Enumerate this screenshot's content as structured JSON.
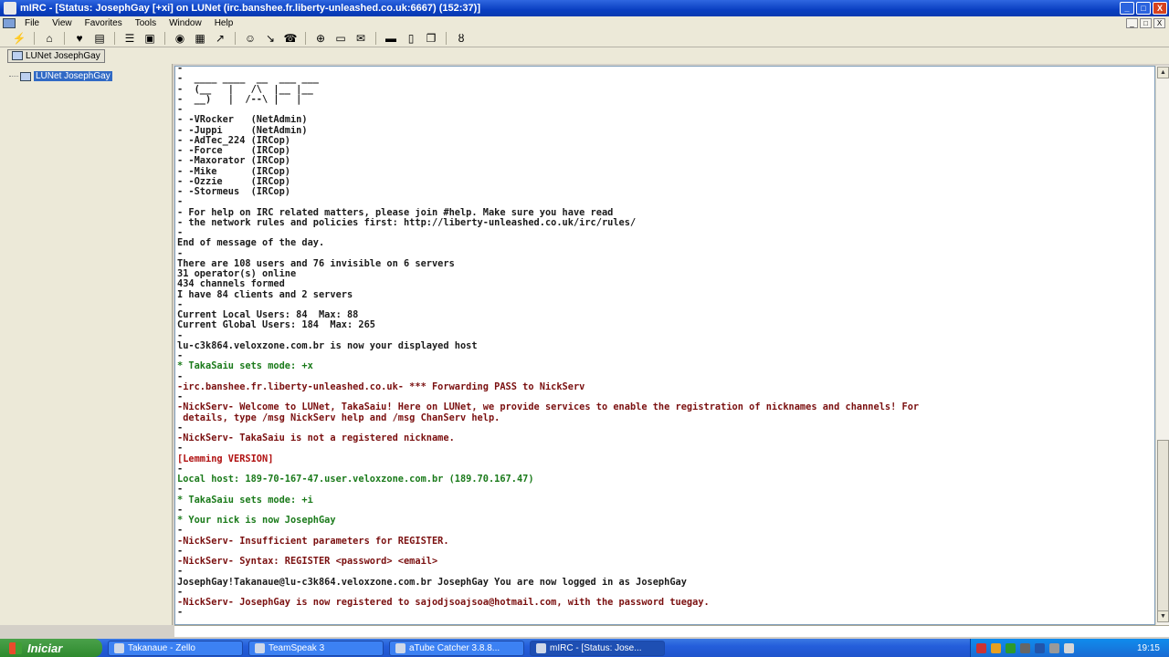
{
  "window": {
    "title": "mIRC - [Status: JosephGay [+xi] on LUNet (irc.banshee.fr.liberty-unleashed.co.uk:6667) (152:37)]",
    "controls": [
      "_",
      "□",
      "X"
    ]
  },
  "menubar": {
    "items": [
      "File",
      "View",
      "Favorites",
      "Tools",
      "Window",
      "Help"
    ],
    "mdi_controls": [
      "_",
      "□",
      "X"
    ]
  },
  "toolbar": {
    "buttons": [
      {
        "name": "connect-icon",
        "glyph": "⚡"
      },
      {
        "name": "options-icon",
        "glyph": "⌂"
      },
      {
        "name": "favorites-icon",
        "glyph": "♥"
      },
      {
        "name": "channel-list-icon",
        "glyph": "▤"
      },
      {
        "name": "address-book-icon",
        "glyph": "☰"
      },
      {
        "name": "remote-icon",
        "glyph": "▣"
      },
      {
        "name": "script-icon",
        "glyph": "◉"
      },
      {
        "name": "colors-icon",
        "glyph": "▦"
      },
      {
        "name": "send-file-icon",
        "glyph": "↗"
      },
      {
        "name": "chat-icon",
        "glyph": "☺"
      },
      {
        "name": "received-icon",
        "glyph": "↘"
      },
      {
        "name": "notify-icon",
        "glyph": "☎"
      },
      {
        "name": "url-list-icon",
        "glyph": "⊕"
      },
      {
        "name": "log-icon",
        "glyph": "▭"
      },
      {
        "name": "message-icon",
        "glyph": "✉"
      },
      {
        "name": "tile-horizontal-icon",
        "glyph": "▬"
      },
      {
        "name": "tile-vertical-icon",
        "glyph": "▯"
      },
      {
        "name": "cascade-icon",
        "glyph": "❐"
      },
      {
        "name": "help-icon",
        "glyph": "ȣ"
      }
    ]
  },
  "switchbar": {
    "tab_label": "LUNet JosephGay"
  },
  "treebar": {
    "item_label": "LUNet JosephGay"
  },
  "log_lines": [
    {
      "text": "-",
      "color": "#1a1a1a"
    },
    {
      "text": "-  ____ ____  __  ___ ___",
      "color": "#1a1a1a"
    },
    {
      "text": "-  (__   |   /\\  |__ |__",
      "color": "#1a1a1a"
    },
    {
      "text": "-  __)   |  /--\\ |   |",
      "color": "#1a1a1a"
    },
    {
      "text": "-",
      "color": "#1a1a1a"
    },
    {
      "text": "- -VRocker   (NetAdmin)",
      "color": "#1a1a1a"
    },
    {
      "text": "- -Juppi     (NetAdmin)",
      "color": "#1a1a1a"
    },
    {
      "text": "- -AdTec_224 (IRCop)",
      "color": "#1a1a1a"
    },
    {
      "text": "- -Force     (IRCop)",
      "color": "#1a1a1a"
    },
    {
      "text": "- -Maxorator (IRCop)",
      "color": "#1a1a1a"
    },
    {
      "text": "- -Mike      (IRCop)",
      "color": "#1a1a1a"
    },
    {
      "text": "- -Ozzie     (IRCop)",
      "color": "#1a1a1a"
    },
    {
      "text": "- -Stormeus  (IRCop)",
      "color": "#1a1a1a"
    },
    {
      "text": "-",
      "color": "#1a1a1a"
    },
    {
      "text": "- For help on IRC related matters, please join #help. Make sure you have read",
      "color": "#1a1a1a"
    },
    {
      "text": "- the network rules and policies first: http://liberty-unleashed.co.uk/irc/rules/",
      "color": "#1a1a1a"
    },
    {
      "text": "-",
      "color": "#1a1a1a"
    },
    {
      "text": "End of message of the day.",
      "color": "#1a1a1a"
    },
    {
      "text": "-",
      "color": "#1a1a1a"
    },
    {
      "text": "There are 108 users and 76 invisible on 6 servers",
      "color": "#1a1a1a"
    },
    {
      "text": "31 operator(s) online",
      "color": "#1a1a1a"
    },
    {
      "text": "434 channels formed",
      "color": "#1a1a1a"
    },
    {
      "text": "I have 84 clients and 2 servers",
      "color": "#1a1a1a"
    },
    {
      "text": "-",
      "color": "#1a1a1a"
    },
    {
      "text": "Current Local Users: 84  Max: 88",
      "color": "#1a1a1a"
    },
    {
      "text": "Current Global Users: 184  Max: 265",
      "color": "#1a1a1a"
    },
    {
      "text": "-",
      "color": "#1a1a1a"
    },
    {
      "text": "lu-c3k864.veloxzone.com.br is now your displayed host",
      "color": "#1a1a1a"
    },
    {
      "text": "-",
      "color": "#1a1a1a"
    },
    {
      "text": "* TakaSaiu sets mode: +x",
      "color": "#1a7a1a"
    },
    {
      "text": "-",
      "color": "#1a1a1a"
    },
    {
      "text": "-irc.banshee.fr.liberty-unleashed.co.uk- *** Forwarding PASS to NickServ",
      "color": "#7a0f0f"
    },
    {
      "text": "-",
      "color": "#1a1a1a"
    },
    {
      "text": "-NickServ- Welcome to LUNet, TakaSaiu! Here on LUNet, we provide services to enable the registration of nicknames and channels! For",
      "color": "#7a0f0f"
    },
    {
      "text": " details, type /msg NickServ help and /msg ChanServ help.",
      "color": "#7a0f0f"
    },
    {
      "text": "-",
      "color": "#1a1a1a"
    },
    {
      "text": "-NickServ- TakaSaiu is not a registered nickname.",
      "color": "#7a0f0f"
    },
    {
      "text": "-",
      "color": "#1a1a1a"
    },
    {
      "text": "[Lemming VERSION]",
      "color": "#b01010"
    },
    {
      "text": "-",
      "color": "#1a1a1a"
    },
    {
      "text": "Local host: 189-70-167-47.user.veloxzone.com.br (189.70.167.47)",
      "color": "#1a7a1a"
    },
    {
      "text": "-",
      "color": "#1a1a1a"
    },
    {
      "text": "* TakaSaiu sets mode: +i",
      "color": "#1a7a1a"
    },
    {
      "text": "-",
      "color": "#1a1a1a"
    },
    {
      "text": "* Your nick is now JosephGay",
      "color": "#1a7a1a"
    },
    {
      "text": "-",
      "color": "#1a1a1a"
    },
    {
      "text": "-NickServ- Insufficient parameters for REGISTER.",
      "color": "#7a0f0f"
    },
    {
      "text": "-",
      "color": "#1a1a1a"
    },
    {
      "text": "-NickServ- Syntax: REGISTER <password> <email>",
      "color": "#7a0f0f"
    },
    {
      "text": "-",
      "color": "#1a1a1a"
    },
    {
      "text": "JosephGay!Takanaue@lu-c3k864.veloxzone.com.br JosephGay You are now logged in as JosephGay",
      "color": "#1a1a1a"
    },
    {
      "text": "-",
      "color": "#1a1a1a"
    },
    {
      "text": "-NickServ- JosephGay is now registered to sajodjsoajsoa@hotmail.com, with the password tuegay.",
      "color": "#7a0f0f"
    },
    {
      "text": "-",
      "color": "#1a1a1a"
    }
  ],
  "taskbar": {
    "start_label": "Iniciar",
    "tasks": [
      {
        "label": "Takanaue - Zello",
        "active": false
      },
      {
        "label": "TeamSpeak 3",
        "active": false
      },
      {
        "label": "aTube Catcher 3.8.8...",
        "active": false
      },
      {
        "label": "mIRC - [Status: Jose...",
        "active": true
      }
    ],
    "clock": "19:15"
  }
}
